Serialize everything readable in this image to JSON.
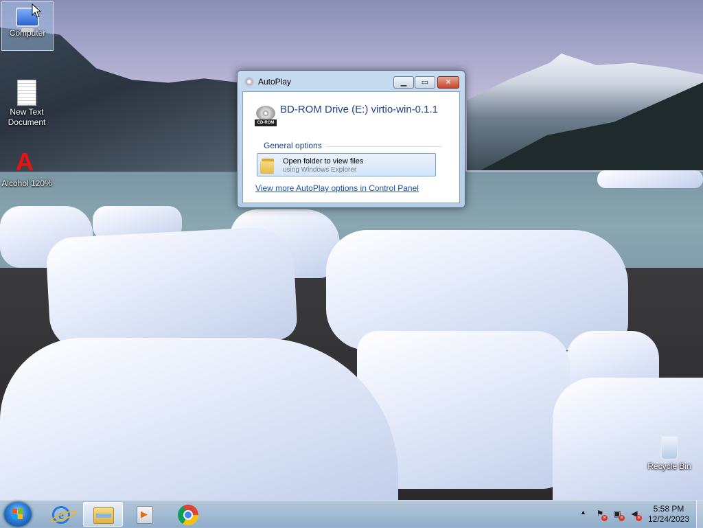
{
  "desktop": {
    "icons": [
      {
        "label": "Computer"
      },
      {
        "label": "New Text Document"
      },
      {
        "label": "Alcohol 120%"
      },
      {
        "label": "Recycle Bin"
      }
    ]
  },
  "autoplay": {
    "title": "AutoPlay",
    "drive_title": "BD-ROM Drive (E:) virtio-win-0.1.1",
    "drive_badge": "CD-ROM",
    "section_label": "General options",
    "option_main": "Open folder to view files",
    "option_sub": "using Windows Explorer",
    "more_link": "View more AutoPlay options in Control Panel",
    "controls": {
      "minimize": "▁",
      "maximize": "▭",
      "close": "✕"
    }
  },
  "taskbar": {
    "pinned": [
      "start-button",
      "internet-explorer",
      "windows-explorer",
      "windows-media-player",
      "google-chrome"
    ],
    "active": "windows-explorer",
    "tray_chevron": "▲",
    "clock_time": "5:58 PM",
    "clock_date": "12/24/2023"
  }
}
